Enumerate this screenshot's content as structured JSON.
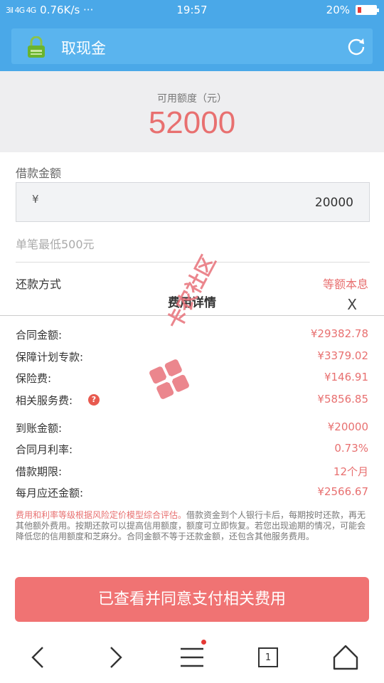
{
  "status_bar": {
    "signal": "3il 4G 4G",
    "speed": "0.76K/s ···",
    "time": "19:57",
    "battery": "20%",
    "battery_level": 0.2
  },
  "header": {
    "title": "取现金"
  },
  "quota": {
    "label": "可用额度（元）",
    "value": "52000"
  },
  "loan": {
    "label": "借款金额",
    "currency": "¥",
    "amount": "20000",
    "min_note": "单笔最低500元"
  },
  "repay": {
    "label": "还款方式",
    "value": "等额本息"
  },
  "fee_sheet": {
    "title": "费用详情",
    "close": "X",
    "rows": [
      {
        "key": "合同金额:",
        "value": "¥29382.78"
      },
      {
        "key": "保障计划专款:",
        "value": "¥3379.02"
      },
      {
        "key": "保险费:",
        "value": "¥146.91"
      },
      {
        "key": "相关服务费:",
        "value": "¥5856.85"
      },
      {
        "key": "到账金额:",
        "value": "¥20000"
      },
      {
        "key": "合同月利率:",
        "value": "0.73%"
      },
      {
        "key": "借款期限:",
        "value": "12个月"
      },
      {
        "key": "每月应还金额:",
        "value": "¥2566.67"
      }
    ],
    "help_symbol": "?",
    "disclaimer_highlight": "费用和利率等级根据风险定价模型综合评估。",
    "disclaimer_rest": "借款资金到个人银行卡后，每期按时还款，再无其他额外费用。按期还款可以提高信用额度，额度可立即恢复。若您出现逾期的情况，可能会降低您的信用额度和芝麻分。合同金额不等于还款金额，还包含其他服务费用。"
  },
  "agree_button": "已查看并同意支付相关费用",
  "watermark_text": "卡农社区",
  "bottom_nav": {
    "tab_count": "1"
  },
  "colors": {
    "primary": "#4aa8e8",
    "accent": "#e87070",
    "button": "#f07373"
  }
}
